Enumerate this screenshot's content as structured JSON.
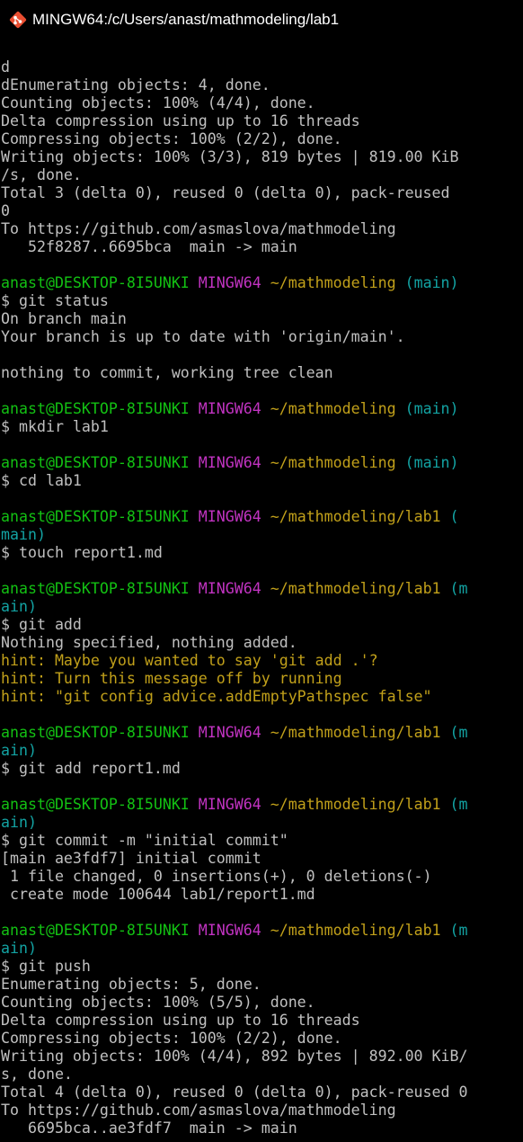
{
  "window": {
    "title": "MINGW64:/c/Users/anast/mathmodeling/lab1",
    "icon": "git-bash-icon"
  },
  "colors": {
    "background": "#000000",
    "default_text": "#c0c0c0",
    "green": "#13c113",
    "magenta": "#c133c1",
    "yellow": "#c1a01a",
    "cyan": "#13a3a3"
  },
  "terminal": {
    "lines": [
      [
        {
          "t": "d",
          "c": "default"
        }
      ],
      [
        {
          "t": "dEnumerating objects: 4, done.",
          "c": "default"
        }
      ],
      [
        {
          "t": "Counting objects: 100% (4/4), done.",
          "c": "default"
        }
      ],
      [
        {
          "t": "Delta compression using up to 16 threads",
          "c": "default"
        }
      ],
      [
        {
          "t": "Compressing objects: 100% (2/2), done.",
          "c": "default"
        }
      ],
      [
        {
          "t": "Writing objects: 100% (3/3), 819 bytes | 819.00 KiB",
          "c": "default"
        }
      ],
      [
        {
          "t": "/s, done.",
          "c": "default"
        }
      ],
      [
        {
          "t": "Total 3 (delta 0), reused 0 (delta 0), pack-reused",
          "c": "default"
        }
      ],
      [
        {
          "t": "0",
          "c": "default"
        }
      ],
      [
        {
          "t": "To https://github.com/asmaslova/mathmodeling",
          "c": "default"
        }
      ],
      [
        {
          "t": "   52f8287..6695bca  main -> main",
          "c": "default"
        }
      ],
      [],
      [
        {
          "t": "anast@DESKTOP-8I5UNKI",
          "c": "green"
        },
        {
          "t": " ",
          "c": "default"
        },
        {
          "t": "MINGW64",
          "c": "magenta"
        },
        {
          "t": " ",
          "c": "default"
        },
        {
          "t": "~/mathmodeling",
          "c": "yellow"
        },
        {
          "t": " (main)",
          "c": "cyan"
        }
      ],
      [
        {
          "t": "$ git status",
          "c": "default"
        }
      ],
      [
        {
          "t": "On branch main",
          "c": "default"
        }
      ],
      [
        {
          "t": "Your branch is up to date with 'origin/main'.",
          "c": "default"
        }
      ],
      [],
      [
        {
          "t": "nothing to commit, working tree clean",
          "c": "default"
        }
      ],
      [],
      [
        {
          "t": "anast@DESKTOP-8I5UNKI",
          "c": "green"
        },
        {
          "t": " ",
          "c": "default"
        },
        {
          "t": "MINGW64",
          "c": "magenta"
        },
        {
          "t": " ",
          "c": "default"
        },
        {
          "t": "~/mathmodeling",
          "c": "yellow"
        },
        {
          "t": " (main)",
          "c": "cyan"
        }
      ],
      [
        {
          "t": "$ mkdir lab1",
          "c": "default"
        }
      ],
      [],
      [
        {
          "t": "anast@DESKTOP-8I5UNKI",
          "c": "green"
        },
        {
          "t": " ",
          "c": "default"
        },
        {
          "t": "MINGW64",
          "c": "magenta"
        },
        {
          "t": " ",
          "c": "default"
        },
        {
          "t": "~/mathmodeling",
          "c": "yellow"
        },
        {
          "t": " (main)",
          "c": "cyan"
        }
      ],
      [
        {
          "t": "$ cd lab1",
          "c": "default"
        }
      ],
      [],
      [
        {
          "t": "anast@DESKTOP-8I5UNKI",
          "c": "green"
        },
        {
          "t": " ",
          "c": "default"
        },
        {
          "t": "MINGW64",
          "c": "magenta"
        },
        {
          "t": " ",
          "c": "default"
        },
        {
          "t": "~/mathmodeling/lab1",
          "c": "yellow"
        },
        {
          "t": " (",
          "c": "cyan"
        }
      ],
      [
        {
          "t": "main)",
          "c": "cyan"
        }
      ],
      [
        {
          "t": "$ touch report1.md",
          "c": "default"
        }
      ],
      [],
      [
        {
          "t": "anast@DESKTOP-8I5UNKI",
          "c": "green"
        },
        {
          "t": " ",
          "c": "default"
        },
        {
          "t": "MINGW64",
          "c": "magenta"
        },
        {
          "t": " ",
          "c": "default"
        },
        {
          "t": "~/mathmodeling/lab1",
          "c": "yellow"
        },
        {
          "t": " (m",
          "c": "cyan"
        }
      ],
      [
        {
          "t": "ain)",
          "c": "cyan"
        }
      ],
      [
        {
          "t": "$ git add",
          "c": "default"
        }
      ],
      [
        {
          "t": "Nothing specified, nothing added.",
          "c": "default"
        }
      ],
      [
        {
          "t": "hint: Maybe you wanted to say 'git add .'?",
          "c": "yellow"
        }
      ],
      [
        {
          "t": "hint: Turn this message off by running",
          "c": "yellow"
        }
      ],
      [
        {
          "t": "hint: \"git config advice.addEmptyPathspec false\"",
          "c": "yellow"
        }
      ],
      [],
      [
        {
          "t": "anast@DESKTOP-8I5UNKI",
          "c": "green"
        },
        {
          "t": " ",
          "c": "default"
        },
        {
          "t": "MINGW64",
          "c": "magenta"
        },
        {
          "t": " ",
          "c": "default"
        },
        {
          "t": "~/mathmodeling/lab1",
          "c": "yellow"
        },
        {
          "t": " (m",
          "c": "cyan"
        }
      ],
      [
        {
          "t": "ain)",
          "c": "cyan"
        }
      ],
      [
        {
          "t": "$ git add report1.md",
          "c": "default"
        }
      ],
      [],
      [
        {
          "t": "anast@DESKTOP-8I5UNKI",
          "c": "green"
        },
        {
          "t": " ",
          "c": "default"
        },
        {
          "t": "MINGW64",
          "c": "magenta"
        },
        {
          "t": " ",
          "c": "default"
        },
        {
          "t": "~/mathmodeling/lab1",
          "c": "yellow"
        },
        {
          "t": " (m",
          "c": "cyan"
        }
      ],
      [
        {
          "t": "ain)",
          "c": "cyan"
        }
      ],
      [
        {
          "t": "$ git commit -m \"initial commit\"",
          "c": "default"
        }
      ],
      [
        {
          "t": "[main ae3fdf7] initial commit",
          "c": "default"
        }
      ],
      [
        {
          "t": " 1 file changed, 0 insertions(+), 0 deletions(-)",
          "c": "default"
        }
      ],
      [
        {
          "t": " create mode 100644 lab1/report1.md",
          "c": "default"
        }
      ],
      [],
      [
        {
          "t": "anast@DESKTOP-8I5UNKI",
          "c": "green"
        },
        {
          "t": " ",
          "c": "default"
        },
        {
          "t": "MINGW64",
          "c": "magenta"
        },
        {
          "t": " ",
          "c": "default"
        },
        {
          "t": "~/mathmodeling/lab1",
          "c": "yellow"
        },
        {
          "t": " (m",
          "c": "cyan"
        }
      ],
      [
        {
          "t": "ain)",
          "c": "cyan"
        }
      ],
      [
        {
          "t": "$ git push",
          "c": "default"
        }
      ],
      [
        {
          "t": "Enumerating objects: 5, done.",
          "c": "default"
        }
      ],
      [
        {
          "t": "Counting objects: 100% (5/5), done.",
          "c": "default"
        }
      ],
      [
        {
          "t": "Delta compression using up to 16 threads",
          "c": "default"
        }
      ],
      [
        {
          "t": "Compressing objects: 100% (2/2), done.",
          "c": "default"
        }
      ],
      [
        {
          "t": "Writing objects: 100% (4/4), 892 bytes | 892.00 KiB/",
          "c": "default"
        }
      ],
      [
        {
          "t": "s, done.",
          "c": "default"
        }
      ],
      [
        {
          "t": "Total 4 (delta 0), reused 0 (delta 0), pack-reused 0",
          "c": "default"
        }
      ],
      [
        {
          "t": "To https://github.com/asmaslova/mathmodeling",
          "c": "default"
        }
      ],
      [
        {
          "t": "   6695bca..ae3fdf7  main -> main",
          "c": "default"
        }
      ]
    ]
  }
}
